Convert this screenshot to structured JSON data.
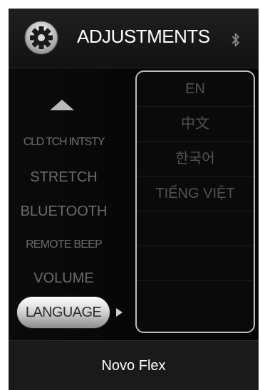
{
  "header": {
    "icon": "gear-icon",
    "title": "ADJUSTMENTS",
    "status_icon": "bluetooth-icon"
  },
  "menu": {
    "scroll_up_icon": "triangle-up-icon",
    "items": [
      {
        "label": "CLD TCH INTSTY"
      },
      {
        "label": "STRETCH"
      },
      {
        "label": "BLUETOOTH"
      },
      {
        "label": "REMOTE BEEP"
      },
      {
        "label": "VOLUME"
      }
    ],
    "selected": {
      "label": "LANGUAGE",
      "indicator_icon": "triangle-right-icon"
    }
  },
  "language_panel": {
    "options": [
      "EN",
      "中文",
      "한국어",
      "TIẾNG VIỆT",
      "",
      "",
      ""
    ]
  },
  "footer": {
    "model": "Novo Flex"
  },
  "colors": {
    "background": "#050505",
    "menu_text": "#6c6c6c",
    "option_text": "#525252",
    "panel_border": "#bdbdbd",
    "header_text": "#ffffff"
  }
}
